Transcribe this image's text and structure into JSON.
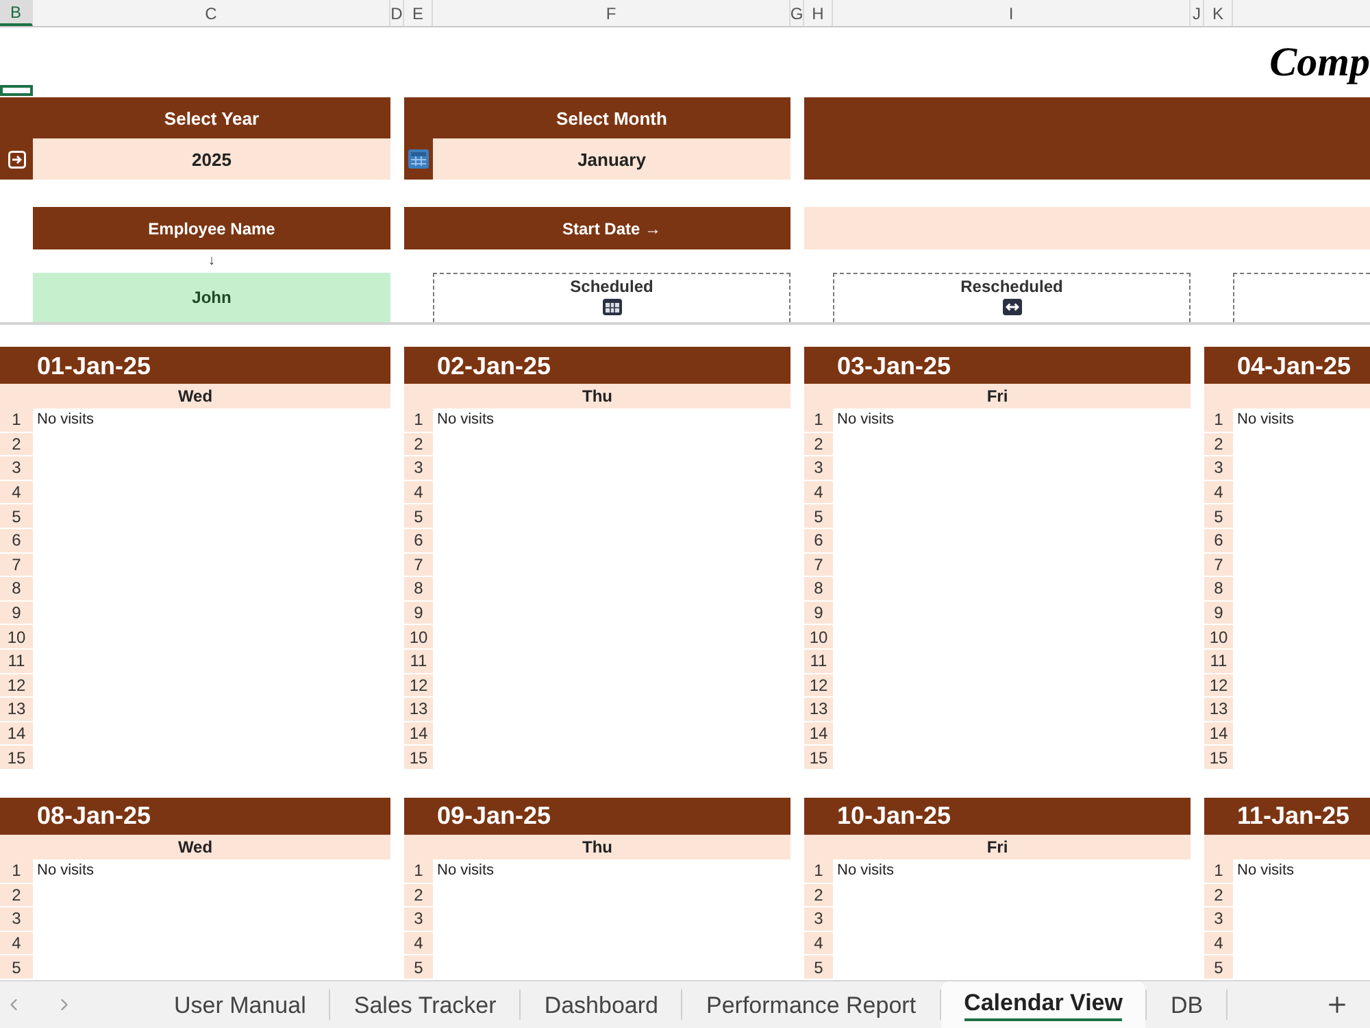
{
  "column_headers": [
    {
      "label": "B",
      "selected": true
    },
    {
      "label": "C",
      "selected": false
    },
    {
      "label": "D",
      "selected": false
    },
    {
      "label": "E",
      "selected": false
    },
    {
      "label": "F",
      "selected": false
    },
    {
      "label": "G",
      "selected": false
    },
    {
      "label": "H",
      "selected": false
    },
    {
      "label": "I",
      "selected": false
    },
    {
      "label": "J",
      "selected": false
    },
    {
      "label": "K",
      "selected": false
    }
  ],
  "title": "Comp",
  "filters": [
    {
      "label": "Select Year",
      "value": "2025"
    },
    {
      "label": "Select Month",
      "value": "January"
    }
  ],
  "employee": {
    "label": "Employee Name",
    "hint": "↓",
    "value": "John"
  },
  "start_date": {
    "label": "Start Date →"
  },
  "legend": [
    {
      "label": "Scheduled"
    },
    {
      "label": "Rescheduled"
    }
  ],
  "weeks": [
    {
      "days": [
        {
          "date": "01-Jan-25",
          "day": "Wed",
          "rows": [
            {
              "number": "1",
              "text": "No visits"
            },
            {
              "number": "2"
            },
            {
              "number": "3"
            },
            {
              "number": "4"
            },
            {
              "number": "5"
            },
            {
              "number": "6"
            },
            {
              "number": "7"
            },
            {
              "number": "8"
            },
            {
              "number": "9"
            },
            {
              "number": "10"
            },
            {
              "number": "11"
            },
            {
              "number": "12"
            },
            {
              "number": "13"
            },
            {
              "number": "14"
            },
            {
              "number": "15"
            }
          ]
        },
        {
          "date": "02-Jan-25",
          "day": "Thu",
          "rows": [
            {
              "number": "1",
              "text": "No visits"
            },
            {
              "number": "2"
            },
            {
              "number": "3"
            },
            {
              "number": "4"
            },
            {
              "number": "5"
            },
            {
              "number": "6"
            },
            {
              "number": "7"
            },
            {
              "number": "8"
            },
            {
              "number": "9"
            },
            {
              "number": "10"
            },
            {
              "number": "11"
            },
            {
              "number": "12"
            },
            {
              "number": "13"
            },
            {
              "number": "14"
            },
            {
              "number": "15"
            }
          ]
        },
        {
          "date": "03-Jan-25",
          "day": "Fri",
          "rows": [
            {
              "number": "1",
              "text": "No visits"
            },
            {
              "number": "2"
            },
            {
              "number": "3"
            },
            {
              "number": "4"
            },
            {
              "number": "5"
            },
            {
              "number": "6"
            },
            {
              "number": "7"
            },
            {
              "number": "8"
            },
            {
              "number": "9"
            },
            {
              "number": "10"
            },
            {
              "number": "11"
            },
            {
              "number": "12"
            },
            {
              "number": "13"
            },
            {
              "number": "14"
            },
            {
              "number": "15"
            }
          ]
        },
        {
          "date": "04-Jan-25",
          "rows": [
            {
              "number": "1",
              "text": "No visits"
            },
            {
              "number": "2"
            },
            {
              "number": "3"
            },
            {
              "number": "4"
            },
            {
              "number": "5"
            },
            {
              "number": "6"
            },
            {
              "number": "7"
            },
            {
              "number": "8"
            },
            {
              "number": "9"
            },
            {
              "number": "10"
            },
            {
              "number": "11"
            },
            {
              "number": "12"
            },
            {
              "number": "13"
            },
            {
              "number": "14"
            },
            {
              "number": "15"
            }
          ]
        }
      ]
    },
    {
      "days": [
        {
          "date": "08-Jan-25",
          "day": "Wed",
          "rows": [
            {
              "number": "1",
              "text": "No visits"
            },
            {
              "number": "2"
            },
            {
              "number": "3"
            },
            {
              "number": "4"
            },
            {
              "number": "5"
            }
          ]
        },
        {
          "date": "09-Jan-25",
          "day": "Thu",
          "rows": [
            {
              "number": "1",
              "text": "No visits"
            },
            {
              "number": "2"
            },
            {
              "number": "3"
            },
            {
              "number": "4"
            },
            {
              "number": "5"
            }
          ]
        },
        {
          "date": "10-Jan-25",
          "day": "Fri",
          "rows": [
            {
              "number": "1",
              "text": "No visits"
            },
            {
              "number": "2"
            },
            {
              "number": "3"
            },
            {
              "number": "4"
            },
            {
              "number": "5"
            }
          ]
        },
        {
          "date": "11-Jan-25",
          "rows": [
            {
              "number": "1",
              "text": "No visits"
            },
            {
              "number": "2"
            },
            {
              "number": "3"
            },
            {
              "number": "4"
            },
            {
              "number": "5"
            }
          ]
        }
      ]
    }
  ],
  "sheet_tabs": [
    {
      "label": "User Manual",
      "selected": false
    },
    {
      "label": "Sales Tracker",
      "selected": false
    },
    {
      "label": "Dashboard",
      "selected": false
    },
    {
      "label": "Performance Report",
      "selected": false
    },
    {
      "label": "Calendar View",
      "selected": true
    },
    {
      "label": "DB",
      "selected": false
    }
  ]
}
